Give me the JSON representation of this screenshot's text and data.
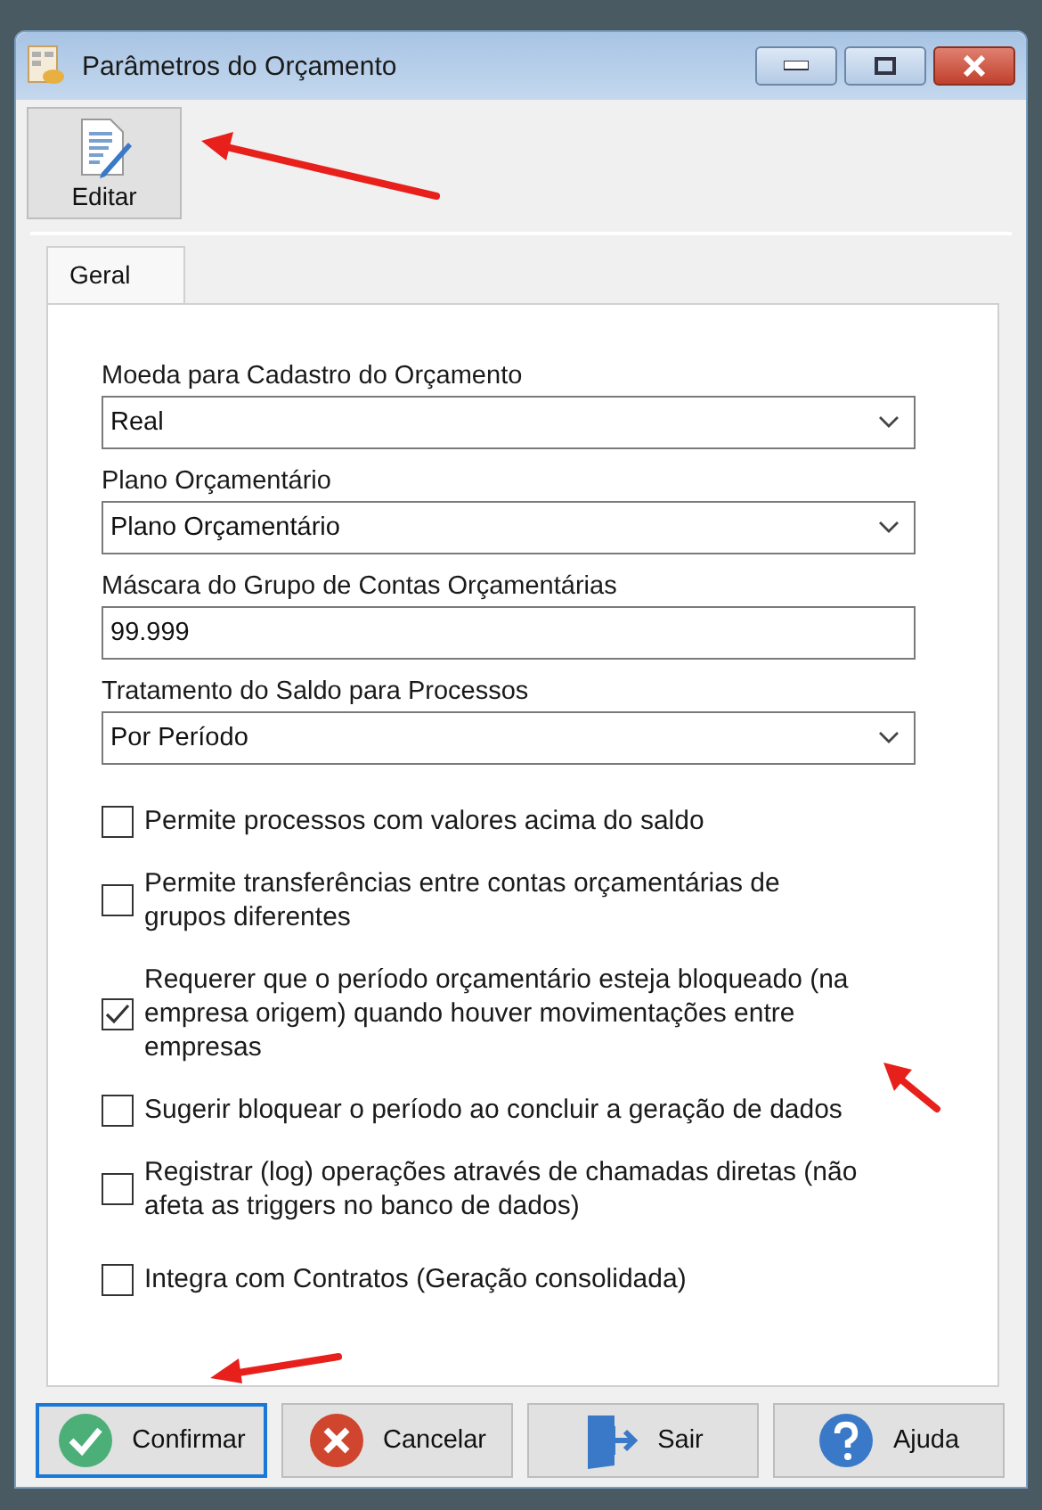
{
  "window": {
    "title": "Parâmetros do Orçamento"
  },
  "toolbar": [
    {
      "kind": "edit",
      "label": "Editar"
    }
  ],
  "tabs": [
    {
      "label": "Geral",
      "selected": true
    }
  ],
  "fields": [
    {
      "kind": "dropdown",
      "label": "Moeda para Cadastro do Orçamento",
      "value": "Real"
    },
    {
      "kind": "dropdown",
      "label": "Plano Orçamentário",
      "value": "Plano Orçamentário"
    },
    {
      "kind": "text",
      "label": "Máscara do Grupo de Contas Orçamentárias",
      "value": "99.999"
    },
    {
      "kind": "dropdown",
      "label": "Tratamento do Saldo para Processos",
      "value": "Por Período"
    }
  ],
  "options": [
    {
      "label": "Permite processos com valores acima do saldo",
      "checked": false
    },
    {
      "label": "Permite transferências entre contas orçamentárias de grupos diferentes",
      "checked": false
    },
    {
      "label": "Requerer que o período orçamentário esteja bloqueado (na empresa origem) quando houver movimentações entre empresas",
      "checked": true
    },
    {
      "label": "Sugerir bloquear o período ao concluir a geração de dados",
      "checked": false
    },
    {
      "label": "Registrar (log) operações através de chamadas diretas (não afeta as triggers no banco de dados)",
      "checked": false
    },
    {
      "label": "Integra com Contratos (Geração consolidada)",
      "checked": false
    }
  ],
  "buttons": [
    {
      "kind": "confirm",
      "label": "Confirmar",
      "focused": true
    },
    {
      "kind": "cancel",
      "label": "Cancelar",
      "focused": false
    },
    {
      "kind": "exit",
      "label": "Sair",
      "focused": false
    },
    {
      "kind": "help",
      "label": "Ajuda",
      "focused": false
    }
  ]
}
